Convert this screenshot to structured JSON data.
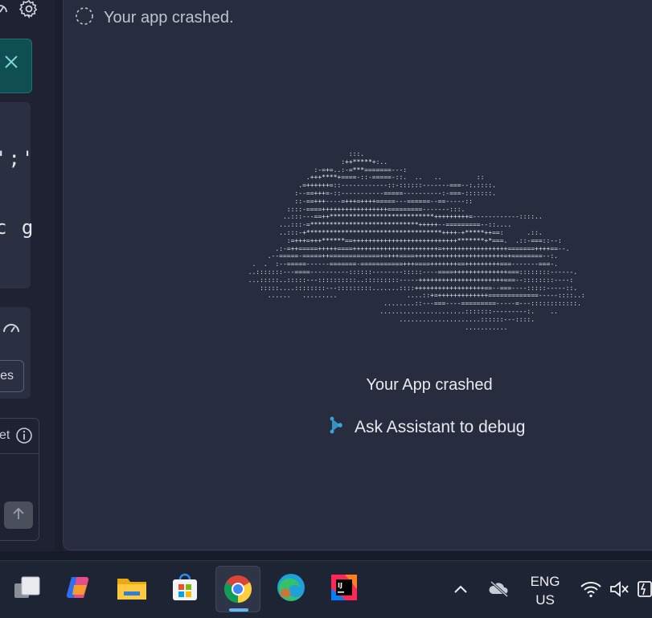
{
  "main": {
    "status_text": "Your app crashed.",
    "crash_title": "Your App crashed",
    "ask_label": "Ask Assistant to debug",
    "ascii_art": [
      "                            :::.",
      "                          :++*****+:..",
      "                   :-=+=..:-=***=======---:",
      "                 .+++****+====-::-=====-::.  ..   ..         ::",
      "               .=++++++=::------------::-::::::-------===--:.::::.",
      "              :--==+++=-::-----------=====----------:-===-:::::::.",
      "              ::-==+++----=+++=++++=====---======--==-----::",
      "            ::::-====+++++++++++++++++=========-------:::.",
      "           ..:::---==++***************************+++++++++=------------::::..",
      "          ...:::-=****************************+++++--=========--::....",
      "          ..:::-+***********************************++++-+*****++==:      .::.",
      "            :=+++=+++******==+++++++++++++++++++++++++++*******+*===.  .::-===::--:",
      "         .:-=++=====+++++====++++++++++++++++++++++=+++++++++++++++++=======++++==--.",
      "       .--=====-=====++=============+=+++====+++++++++++++++++++++++=+========--:.",
      "   .  .  :--=====------=======-===========+++====+++++++==+++++++++===-------===-.",
      "  ..:::::::---====----------::::::--------:::::----====++++++++++++++===::::::::------.",
      "  ...:::::..:::::---::::::::::..:::::::::-----++++++++++++++++++++++===--::::::::----:",
      "     :::::....::::::::---:::::::::.......::::++++++++++++++++++==--===----:::::-----::.",
      "       ......   .........                  ....::+=+++++++++++++=============-----::::..:",
      "                                     ........::---===----=========-----=---::::::::::::.",
      "                                    ......................:::::::---------:.    ..",
      "                                         .....................::::::---::::.",
      "                                                          ..........."
    ]
  },
  "left_panel": {
    "code_line_1": "';'",
    "code_line_2": "c g",
    "pill_label": "es",
    "card_label": "et"
  },
  "taskbar": {
    "lang_line_1": "ENG",
    "lang_line_2": "US",
    "icons": [
      "task-view-icon",
      "copilot-icon",
      "file-explorer-icon",
      "microsoft-store-icon",
      "chrome-icon",
      "edge-icon",
      "intellij-icon"
    ],
    "accent": "#63b4f0"
  },
  "colors": {
    "background": "#1e2232",
    "main_panel": "#272c3e",
    "teal_card": "#0f4f52",
    "assistant_icon": "#3aa6d8"
  }
}
